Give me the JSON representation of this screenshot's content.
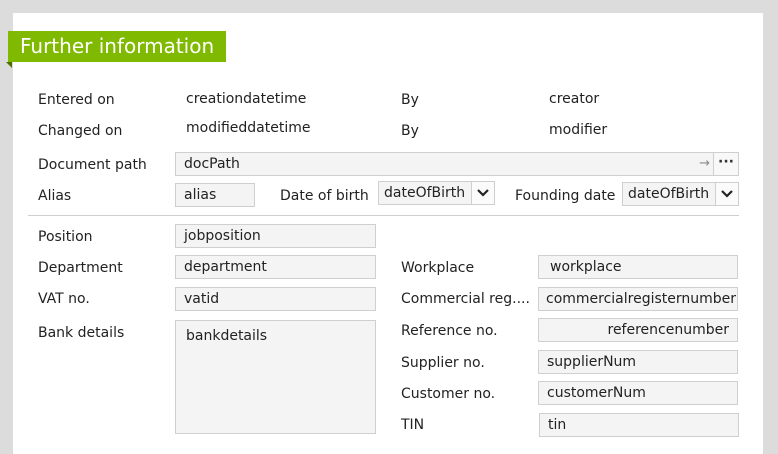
{
  "section": {
    "title": "Further information"
  },
  "meta": {
    "entered_on_label": "Entered on",
    "entered_on_value": "creationdatetime",
    "entered_by_label": "By",
    "entered_by_value": "creator",
    "changed_on_label": "Changed on",
    "changed_on_value": "modifieddatetime",
    "changed_by_label": "By",
    "changed_by_value": "modifier"
  },
  "fields": {
    "document_path": {
      "label": "Document path",
      "value": "docPath"
    },
    "alias": {
      "label": "Alias",
      "value": "alias"
    },
    "date_of_birth": {
      "label": "Date of birth",
      "value": "dateOfBirth"
    },
    "founding_date": {
      "label": "Founding date",
      "value": "dateOfBirth"
    },
    "position": {
      "label": "Position",
      "value": "jobposition"
    },
    "department": {
      "label": "Department",
      "value": "department"
    },
    "vat": {
      "label": "VAT no.",
      "value": "vatid"
    },
    "bank_details": {
      "label": "Bank details",
      "value": "bankdetails"
    },
    "workplace": {
      "label": "Workplace",
      "value": "workplace"
    },
    "commercial_register": {
      "label": "Commercial reg....",
      "value": "commercialregisternumber"
    },
    "reference": {
      "label": "Reference no.",
      "value": "referencenumber"
    },
    "supplier": {
      "label": "Supplier no.",
      "value": "supplierNum"
    },
    "customer": {
      "label": "Customer no.",
      "value": "customerNum"
    },
    "tin": {
      "label": "TIN",
      "value": "tin"
    }
  },
  "icons": {
    "path_arrow": "arrow-right-icon",
    "path_more": "more-icon",
    "dropdown": "chevron-down-icon"
  },
  "colors": {
    "accent": "#7fba00",
    "field_bg": "#f4f4f4",
    "field_border": "#cfcfcf"
  }
}
